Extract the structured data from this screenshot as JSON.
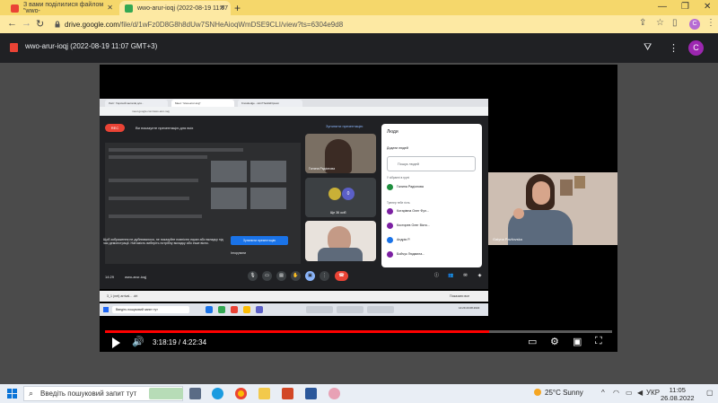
{
  "browser": {
    "tabs": [
      {
        "label": "З вами поділилися файлом \"wwo-",
        "active": false,
        "favicon_color": "#ea4335"
      },
      {
        "label": "wwo-arur-ioqj (2022-08-19 11:07",
        "active": true,
        "favicon_color": "#34a853"
      }
    ],
    "new_tab": "+",
    "url_host": "drive.google.com",
    "url_path": "/file/d/1wFz0D8G8h8dUw7SNHeAioqWmDSE9CLI/view?ts=6304e9d8",
    "window_controls": [
      "—",
      "❐",
      "✕"
    ]
  },
  "drive": {
    "file_title": "wwo-arur-ioqj (2022-08-19 11:07 GMT+3)",
    "avatar_letter": "C",
    "profile_letter": "C"
  },
  "recording": {
    "inner_tabs": [
      "Лист: Гарячий металів для..",
      "Meet: \"wwo-arur-ioqj\"",
      "Knowledge - wlnrThe&lid/Ipsum"
    ],
    "inner_url": "meet.google.com/wwo-arur-ioqj",
    "rec_label": "REC",
    "presenting_note": "Ви показуєте презентацію для всіх",
    "stop_presenting": "Зупинити презентацію",
    "tile_names": [
      "Галина Радіонова",
      "Ще 36 осіб"
    ],
    "tile_badge": "0",
    "hint_text": "Щоб зображення не дублювалося, не показуйте повністю екран або вкладку під час демонстрації. Натомість виберіть потрібну вкладку або інше вікно.",
    "hint_button": "Зупинити презентацію",
    "hint_dismiss": "Ігнорувати",
    "meeting_time": "14:29",
    "meeting_code": "wwo-arur-ioqj",
    "people": {
      "title": "Люди",
      "add": "Додати людей",
      "search_placeholder": "Пошук людей",
      "section1": "У зібранні в групі",
      "section2": "Тренер тебе гість",
      "persons": [
        {
          "name": "Галина Радіонова",
          "color": "#1e8e3e"
        },
        {
          "name": "Котарівна Олег Фул...",
          "color": "#7b1fa2"
        },
        {
          "name": "Костирев Олег Вікто...",
          "color": "#7b1fa2"
        },
        {
          "name": "Андрія Р.",
          "color": "#1a73e8"
        },
        {
          "name": "Бойчук Людмила...",
          "color": "#7b1fa2"
        }
      ]
    },
    "inner_search": "Введіть пошуковий запит тут",
    "inner_clock": "14:29\n23.08.2022",
    "bottom_strip_left": "3_1 (net) arrival... .drt",
    "bottom_strip_right": "Показати все",
    "speaker_name": "Galyna Pavliovska"
  },
  "player": {
    "current_time": "3:18:19",
    "total_time": "4:22:34",
    "time_separator": " / ",
    "progress_fraction": 0.757
  },
  "taskbar": {
    "search_placeholder": "Введіть пошуковий запит тут",
    "weather": "25°C  Sunny",
    "lang": "УКР",
    "time": "11:05",
    "date": "26.08.2022"
  }
}
